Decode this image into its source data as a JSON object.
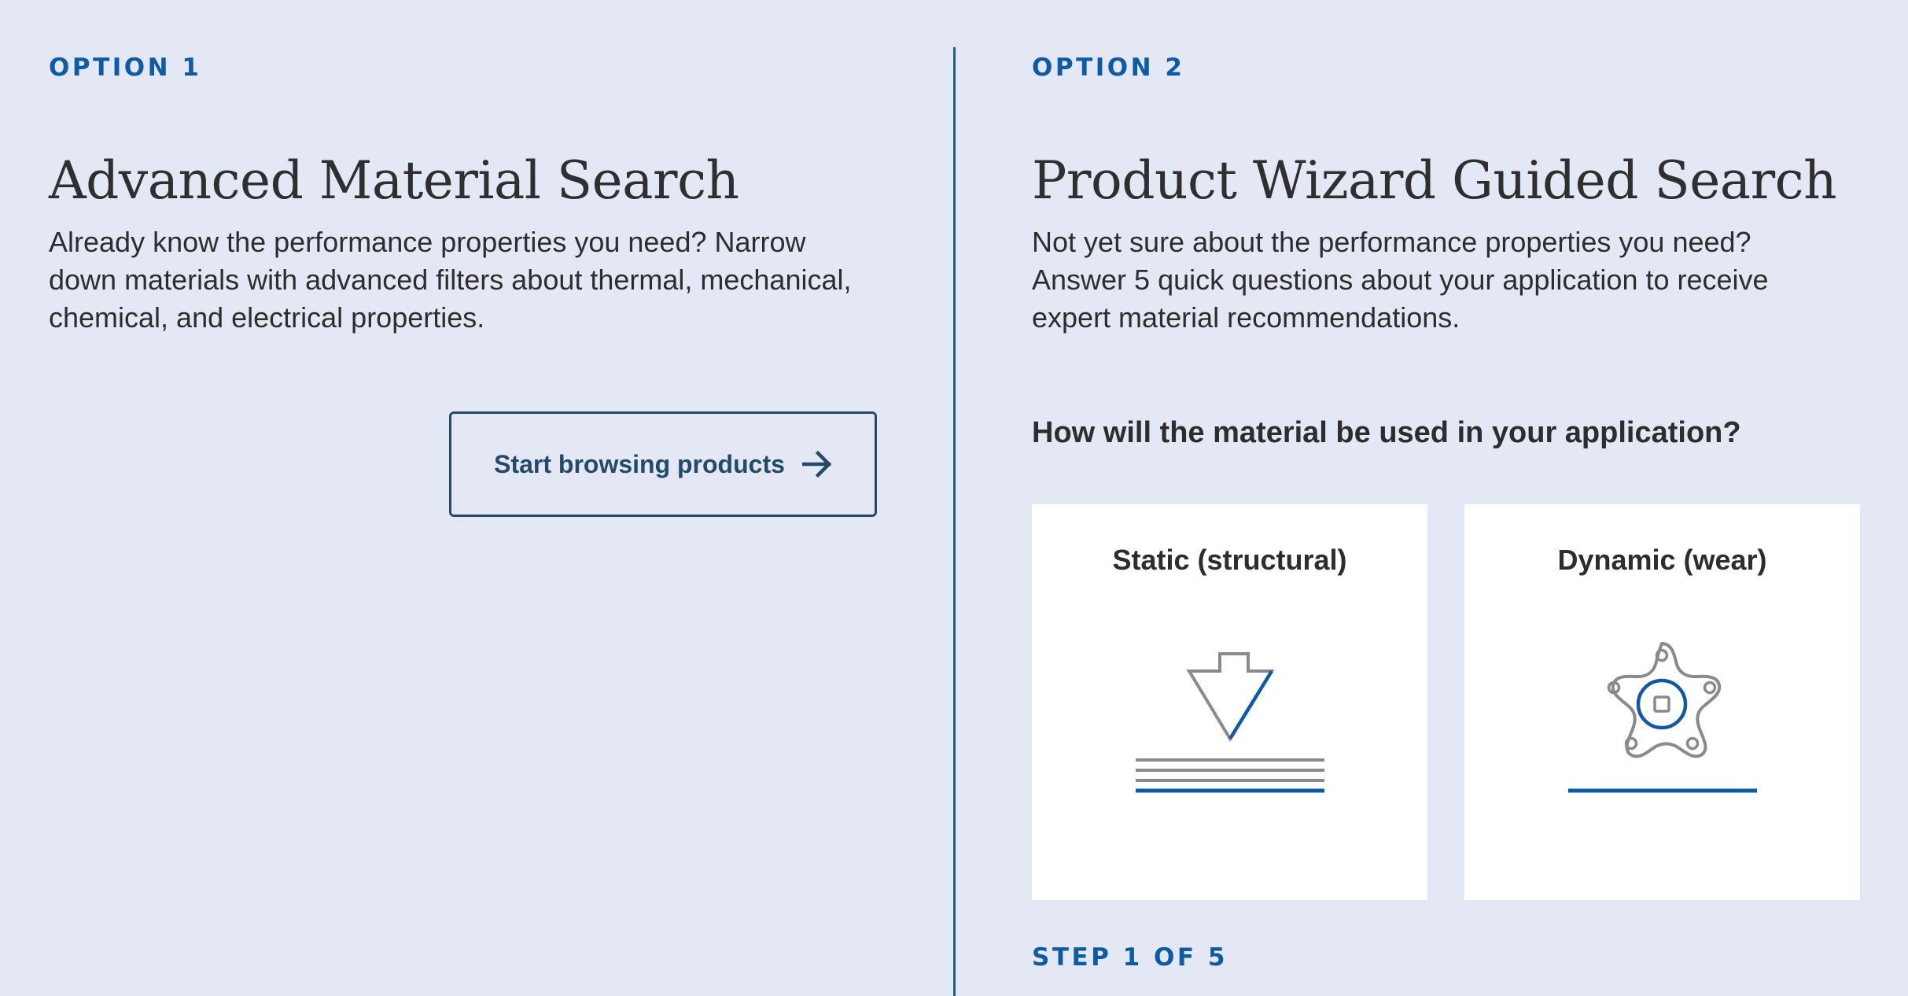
{
  "option1": {
    "eyebrow": "OPTION 1",
    "title": "Advanced Material Search",
    "description": "Already know the performance properties you need? Narrow down materials with advanced filters about thermal, mechanical, chemical, and electrical properties.",
    "button_label": "Start browsing products",
    "button_icon": "arrow-right-icon"
  },
  "option2": {
    "eyebrow": "OPTION 2",
    "title": "Product Wizard Guided Search",
    "description": "Not yet sure about the performance properties you need? Answer 5 quick questions about your application to receive expert material recommendations.",
    "question": "How will the material be used in your application?",
    "choices": [
      {
        "label": "Static (structural)",
        "icon": "downward-force-icon"
      },
      {
        "label": "Dynamic (wear)",
        "icon": "gear-wear-icon"
      }
    ],
    "step": "STEP 1 OF 5"
  },
  "colors": {
    "background": "#e4e8f5",
    "accent_blue": "#0d5aa7",
    "button_navy": "#234a6b",
    "text": "#2d2d2d",
    "card": "#ffffff",
    "icon_gray": "#8a8a8a"
  }
}
